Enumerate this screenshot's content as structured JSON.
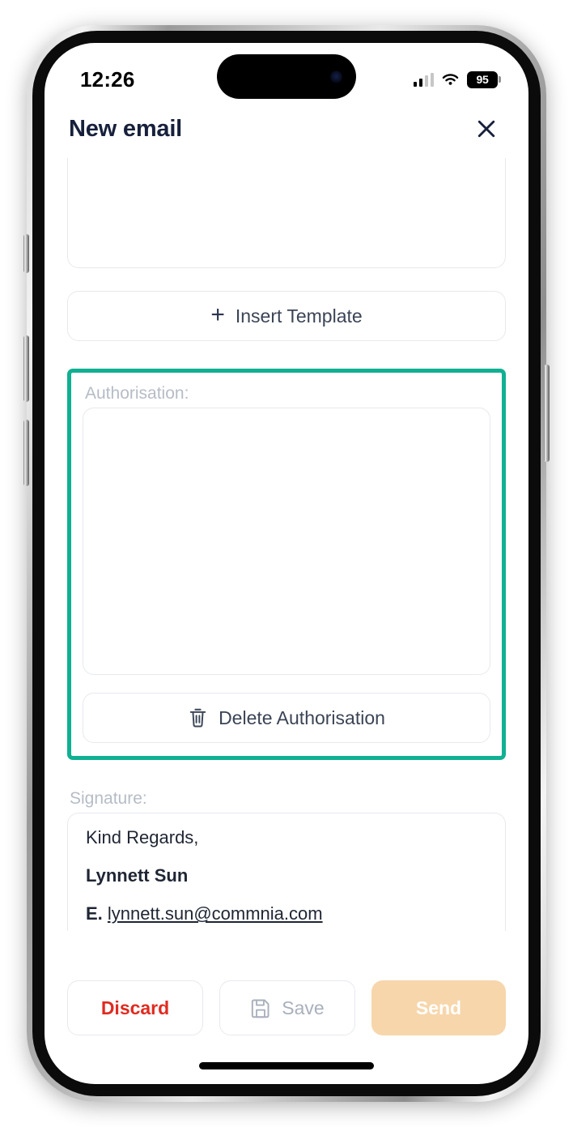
{
  "status_bar": {
    "time": "12:26",
    "signal_icon": "cellular-signal-icon",
    "wifi_icon": "wifi-icon",
    "battery_level": "95"
  },
  "header": {
    "title": "New email",
    "close_icon": "close-icon"
  },
  "body_field": {
    "value": "",
    "placeholder": ""
  },
  "insert_template": {
    "label": "Insert Template",
    "icon": "plus-icon"
  },
  "authorisation": {
    "label": "Authorisation:",
    "value": "",
    "placeholder": "",
    "highlight_color": "#10b092",
    "delete_button": {
      "label": "Delete Authorisation",
      "icon": "trash-icon"
    }
  },
  "signature": {
    "label": "Signature:",
    "lines": [
      {
        "text": "Kind Regards,",
        "style": "normal"
      },
      {
        "text": "Lynnett Sun",
        "style": "bold"
      }
    ],
    "email_line": {
      "prefix": "E.",
      "email": "lynnett.sun@commnia.com"
    }
  },
  "actions": {
    "discard": {
      "label": "Discard",
      "color": "#e02b20"
    },
    "save": {
      "label": "Save",
      "icon": "floppy-disk-icon",
      "color": "#a9b0bc"
    },
    "send": {
      "label": "Send",
      "background": "#f7d6ab",
      "color": "#ffffff"
    }
  }
}
